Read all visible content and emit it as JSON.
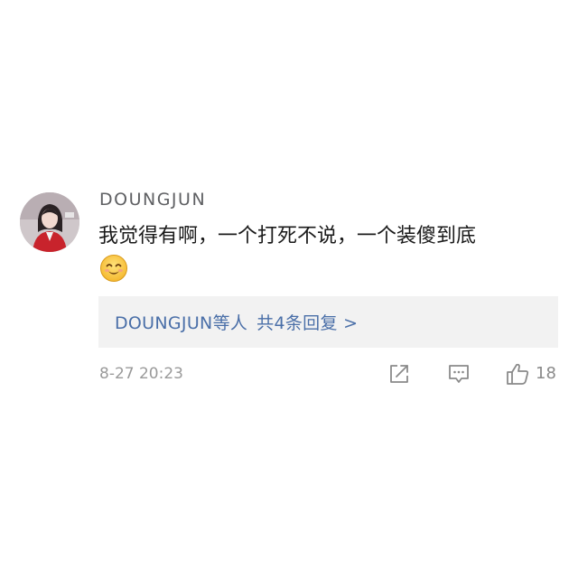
{
  "comment": {
    "username": "DOUNGJUN",
    "text": "我觉得有啊，一个打死不说，一个装傻到底",
    "emoji_icon": "smiling-face-emoji",
    "avatar_icon": "user-avatar-photo"
  },
  "replies": {
    "author": "DOUNGJUN",
    "suffix": "等人",
    "summary": "共4条回复 >",
    "link_color": "#4a6fa8"
  },
  "meta": {
    "timestamp": "8-27 20:23",
    "like_count": "18"
  },
  "actions": {
    "share_icon": "share-icon",
    "comment_icon": "comment-icon",
    "like_icon": "thumbs-up-icon"
  }
}
